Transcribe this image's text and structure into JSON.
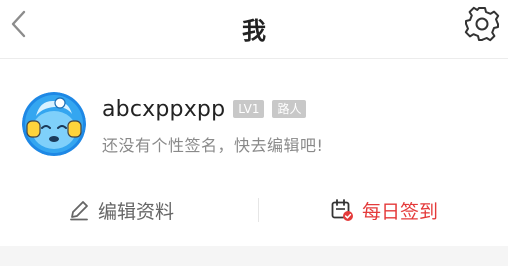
{
  "header": {
    "title": "我",
    "icons": {
      "back": "chevron-left-icon",
      "settings": "gear-icon"
    }
  },
  "profile": {
    "username": "abcxppxpp",
    "level_badge": "LV1",
    "role_badge": "路人",
    "signature": "还没有个性签名，快去编辑吧!"
  },
  "actions": {
    "edit_profile": {
      "label": "编辑资料",
      "icon": "pencil-icon"
    },
    "daily_checkin": {
      "label": "每日签到",
      "icon": "calendar-check-icon"
    }
  },
  "colors": {
    "accent_red": "#e43a3a",
    "badge_gray": "#c8c8c8",
    "avatar_blue": "#1e88e5"
  }
}
